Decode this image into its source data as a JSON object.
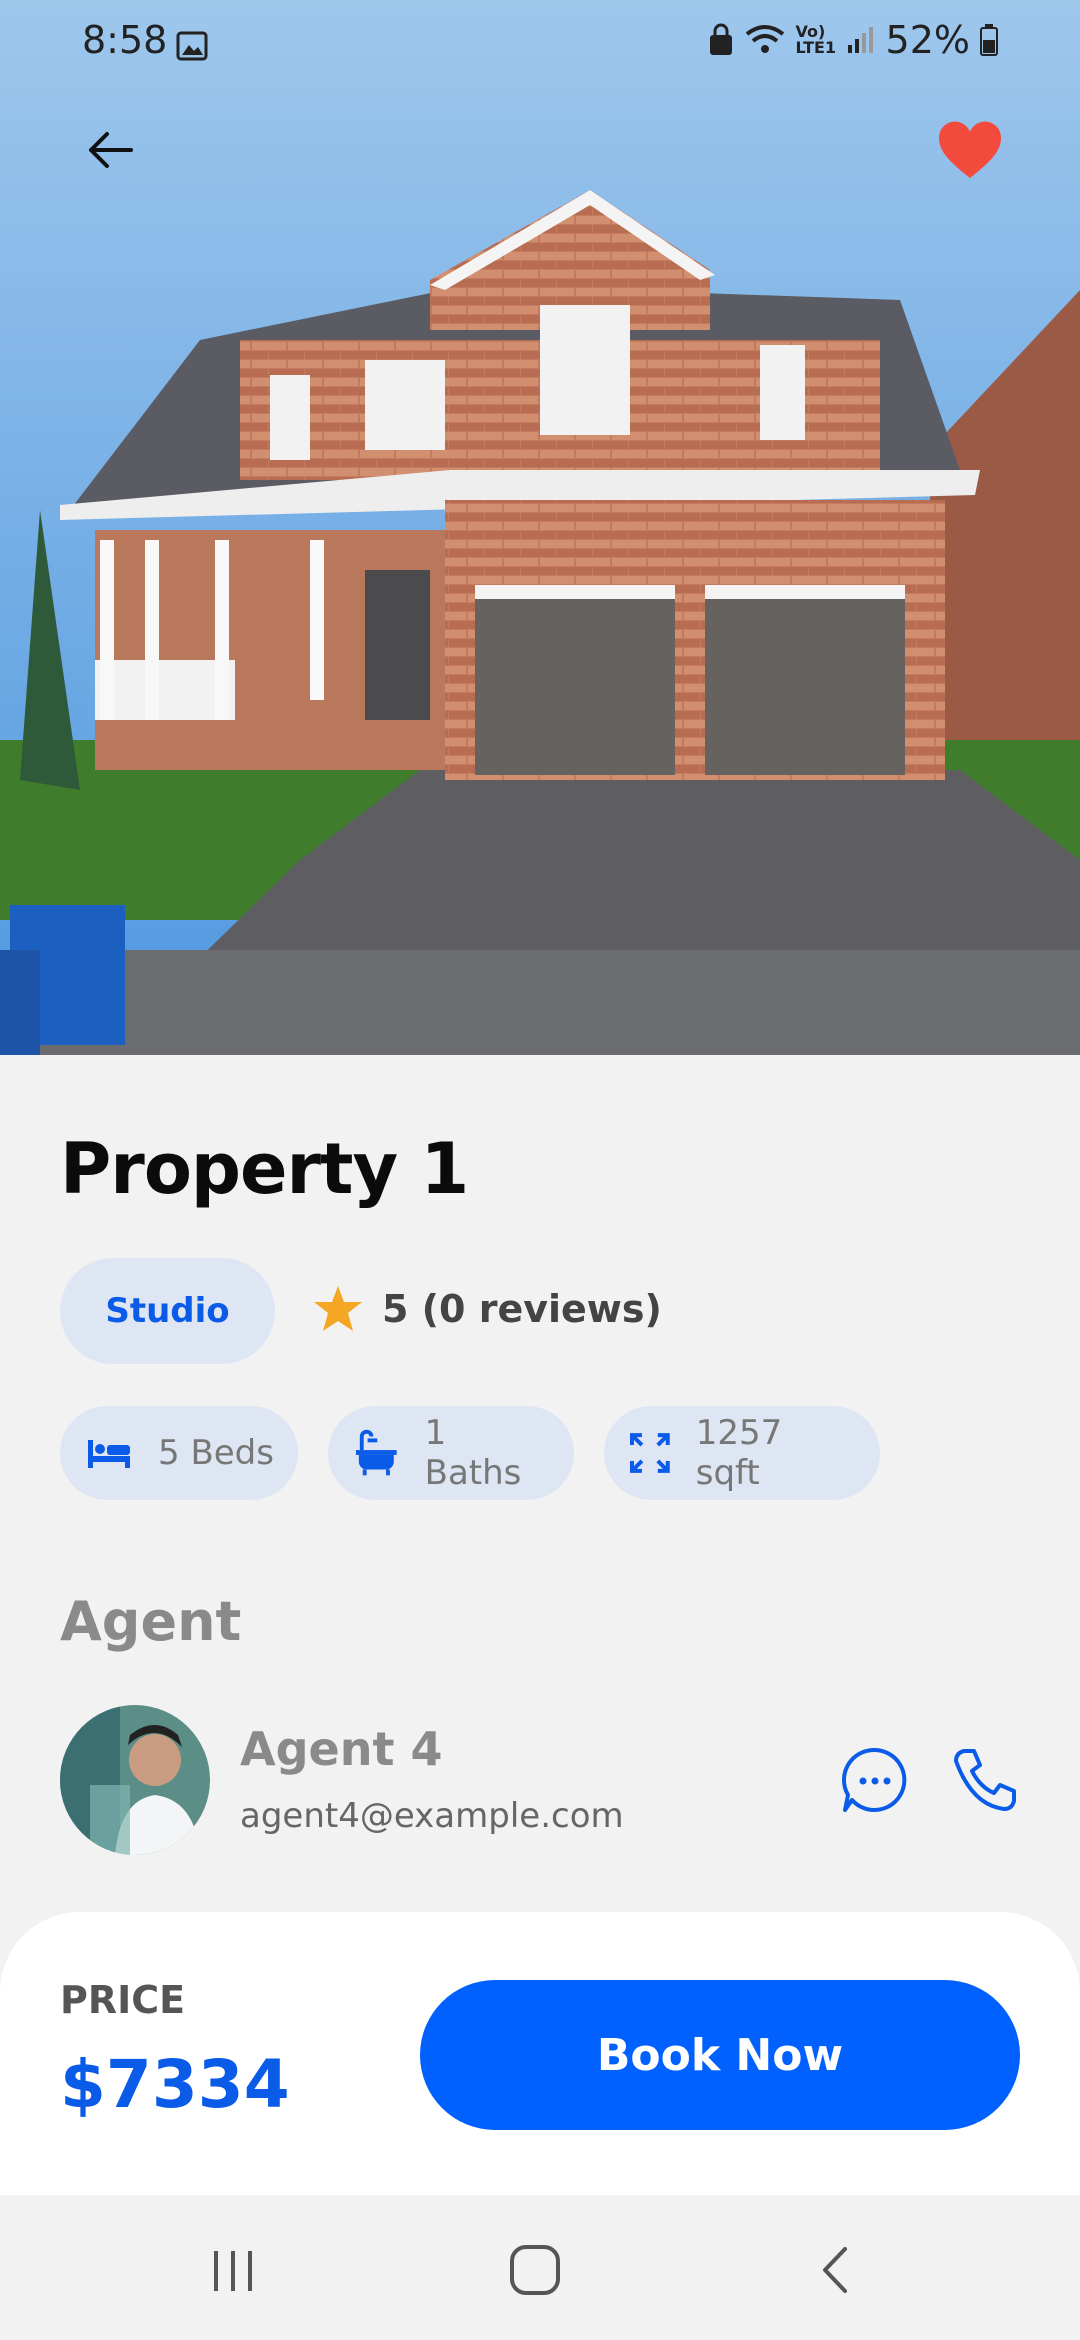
{
  "status_bar": {
    "time": "8:58",
    "network_label": "Vo) LTE1",
    "battery": "52%"
  },
  "header": {
    "back_icon": "arrow-left-icon",
    "favorite_icon": "heart-icon",
    "favorite_color": "#f24a3d"
  },
  "property": {
    "title": "Property 1",
    "type": "Studio",
    "rating": "5 (0 reviews)",
    "features": [
      {
        "icon": "bed-icon",
        "label": "5 Beds"
      },
      {
        "icon": "bathtub-icon",
        "label": "1 Baths"
      },
      {
        "icon": "expand-icon",
        "label": "1257 sqft"
      }
    ]
  },
  "agent": {
    "heading": "Agent",
    "name": "Agent 4",
    "email": "agent4@example.com"
  },
  "booking": {
    "price_label": "PRICE",
    "price": "$7334",
    "button_label": "Book Now"
  },
  "colors": {
    "accent": "#0061ff",
    "pill_bg": "#dfe6f3",
    "star": "#f5a623"
  }
}
